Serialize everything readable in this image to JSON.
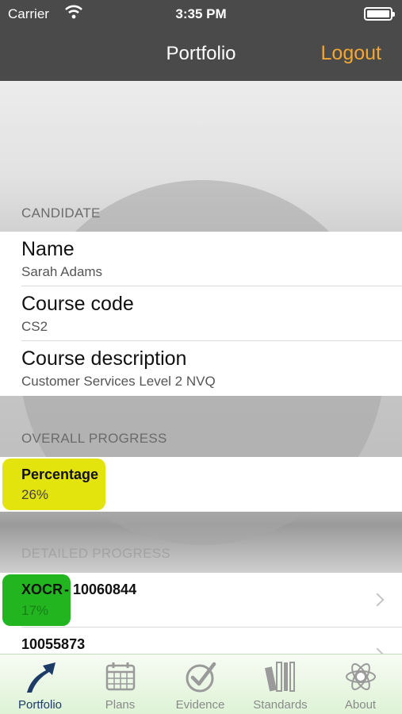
{
  "status_bar": {
    "carrier": "Carrier",
    "time": "3:35 PM"
  },
  "nav": {
    "title": "Portfolio",
    "logout_label": "Logout"
  },
  "candidate": {
    "header": "CANDIDATE",
    "rows": [
      {
        "title": "Name",
        "value": "Sarah Adams"
      },
      {
        "title": "Course code",
        "value": "CS2"
      },
      {
        "title": "Course description",
        "value": "Customer Services Level 2 NVQ"
      }
    ]
  },
  "overall": {
    "header": "OVERALL PROGRESS",
    "label": "Percentage",
    "value": "26%",
    "color": "#e3e30e"
  },
  "detailed": {
    "header": "DETAILED PROGRESS",
    "items": [
      {
        "badge": "XOCR",
        "title": " - 10060844",
        "percent": "17%",
        "color": "#22b520"
      },
      {
        "title": "10055873"
      }
    ]
  },
  "tabs": [
    {
      "label": "Portfolio",
      "icon": "portfolio-arrow-icon",
      "active": true
    },
    {
      "label": "Plans",
      "icon": "calendar-icon",
      "active": false
    },
    {
      "label": "Evidence",
      "icon": "checkmark-icon",
      "active": false
    },
    {
      "label": "Standards",
      "icon": "books-icon",
      "active": false
    },
    {
      "label": "About",
      "icon": "atom-icon",
      "active": false
    }
  ]
}
